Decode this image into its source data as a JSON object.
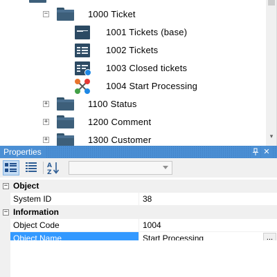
{
  "tree": {
    "items": [
      {
        "label": "1000 Ticket",
        "expander": "−",
        "icon": "folder-icon"
      },
      {
        "label": "1001 Tickets (base)",
        "icon": "table-icon"
      },
      {
        "label": "1002 Tickets",
        "icon": "table-list-icon"
      },
      {
        "label": "1003 Closed tickets",
        "icon": "table-closed-icon"
      },
      {
        "label": "1004 Start Processing",
        "icon": "process-icon"
      },
      {
        "label": "1100 Status",
        "expander": "+",
        "icon": "folder-icon"
      },
      {
        "label": "1200 Comment",
        "expander": "+",
        "icon": "folder-icon"
      },
      {
        "label": "1300 Customer",
        "expander": "+",
        "icon": "folder-icon"
      }
    ]
  },
  "properties": {
    "title": "Properties",
    "pin_glyph": "p",
    "close_glyph": "✕",
    "toolbar": {
      "categorized_icon": "categorized-view-icon",
      "alphabetical_icon": "alphabetical-view-icon",
      "sort_icon": "sort-az-icon",
      "combo_value": ""
    },
    "categories": [
      {
        "label": "Object",
        "expander": "−",
        "rows": [
          {
            "name": "System ID",
            "value": "38"
          }
        ]
      },
      {
        "label": "Information",
        "expander": "−",
        "rows": [
          {
            "name": "Object Code",
            "value": "1004"
          },
          {
            "name": "Object Name",
            "value": "Start Processing",
            "selected": true,
            "ellipsis": "..."
          }
        ]
      }
    ]
  },
  "colors": {
    "panel_header": "#4b8fd4",
    "selection": "#3399ff",
    "folder": "#3d5f7a"
  }
}
